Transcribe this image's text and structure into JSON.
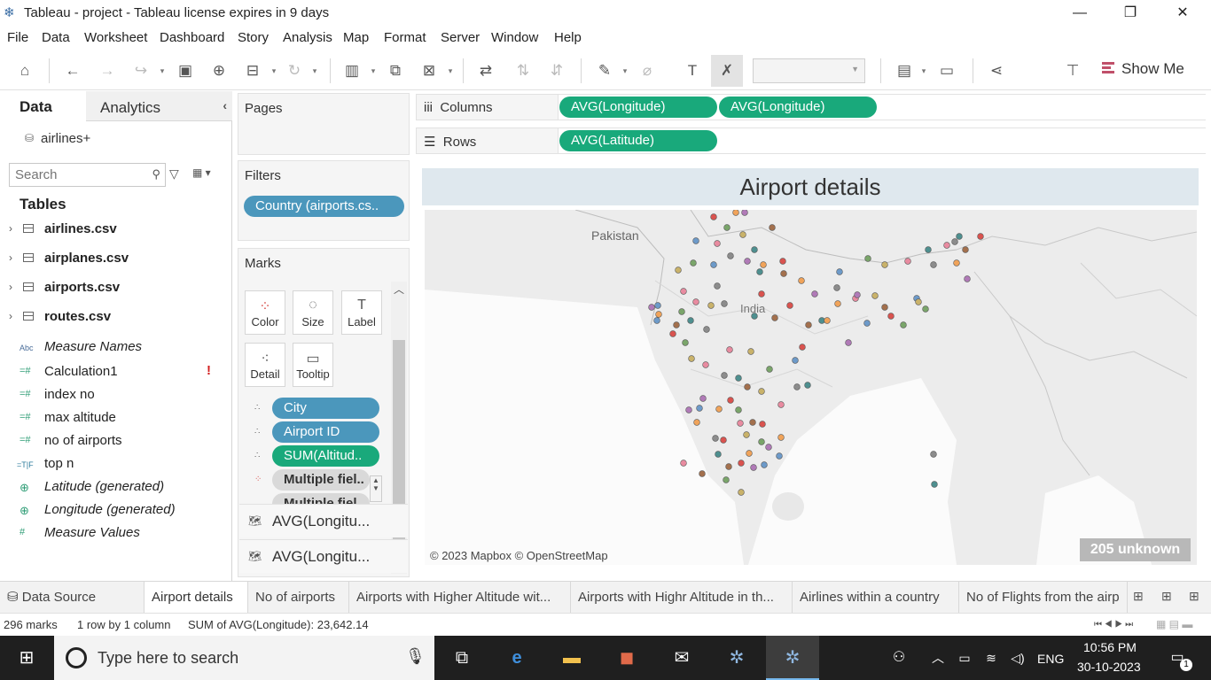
{
  "window": {
    "title": "Tableau - project - Tableau license expires in 9 days",
    "minimize": "—",
    "maximize": "❐",
    "close": "✕"
  },
  "menu": [
    "File",
    "Data",
    "Worksheet",
    "Dashboard",
    "Story",
    "Analysis",
    "Map",
    "Format",
    "Server",
    "Window",
    "Help"
  ],
  "toolbar": {
    "show_me_label": "Show Me"
  },
  "data_pane": {
    "tab_data": "Data",
    "tab_analytics": "Analytics",
    "datasource": "airlines+",
    "search_placeholder": "Search",
    "tables_heading": "Tables",
    "tables": [
      "airlines.csv",
      "airplanes.csv",
      "airports.csv",
      "routes.csv"
    ],
    "fields": [
      {
        "icon": "Abc",
        "name": "Measure Names",
        "italic": true
      },
      {
        "icon": "=#",
        "name": "Calculation1",
        "italic": false,
        "warning": "!"
      },
      {
        "icon": "=#",
        "name": "index no",
        "italic": false
      },
      {
        "icon": "=#",
        "name": "max altitude",
        "italic": false
      },
      {
        "icon": "=#",
        "name": "no of airports",
        "italic": false
      },
      {
        "icon": "=T|F",
        "name": "top n",
        "italic": false
      },
      {
        "icon": "globe",
        "name": "Latitude (generated)",
        "italic": true
      },
      {
        "icon": "globe",
        "name": "Longitude (generated)",
        "italic": true
      },
      {
        "icon": "#",
        "name": "Measure Values",
        "italic": true
      }
    ]
  },
  "pages": {
    "label": "Pages"
  },
  "filters": {
    "label": "Filters",
    "pill": "Country (airports.cs.."
  },
  "marks": {
    "label": "Marks",
    "buttons": [
      "Color",
      "Size",
      "Label",
      "Detail",
      "Tooltip"
    ],
    "pills": [
      "City",
      "Airport ID",
      "SUM(Altitud..",
      "Multiple fiel..",
      "Multiple fiel.."
    ],
    "layers": [
      "AVG(Longitu...",
      "AVG(Longitu..."
    ]
  },
  "columns": {
    "label": "Columns",
    "pills": [
      "AVG(Longitude)",
      "AVG(Longitude)"
    ]
  },
  "rows": {
    "label": "Rows",
    "pills": [
      "AVG(Latitude)"
    ]
  },
  "viz": {
    "title": "Airport details",
    "map_labels": {
      "pakistan": "Pakistan",
      "india": "India"
    },
    "credit": "© 2023 Mapbox © OpenStreetMap",
    "unknown": "205 unknown"
  },
  "sheet_tabs": [
    "Data Source",
    "Airport details",
    "No of airports",
    "Airports with Higher Altitude wit...",
    "Airports with Highr Altitude in th...",
    "Airlines within a country",
    "No of Flights from the airp"
  ],
  "status": {
    "marks": "296 marks",
    "rows": "1 row by 1 column",
    "sum": "SUM of AVG(Longitude): 23,642.14"
  },
  "taskbar": {
    "search_text": "Type here to search",
    "lang": "ENG",
    "time": "10:56 PM",
    "date": "30-10-2023",
    "notification_count": "1"
  },
  "colors": {
    "green_pill": "#19a97b",
    "blue_pill": "#4b97bc",
    "title_band": "#dfe8ee"
  }
}
